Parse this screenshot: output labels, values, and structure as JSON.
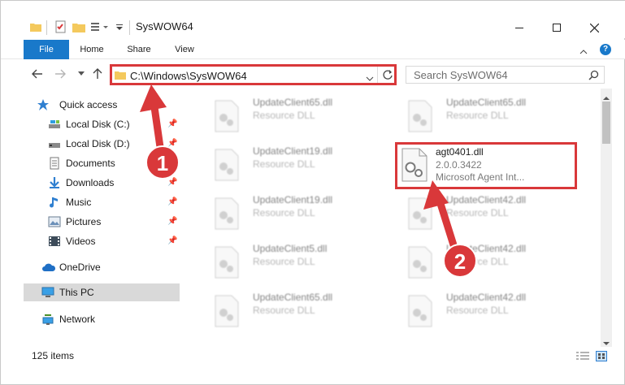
{
  "window": {
    "title": "SysWOW64"
  },
  "ribbon": {
    "tabs": [
      "File",
      "Home",
      "Share",
      "View"
    ],
    "help_label": "?"
  },
  "address": {
    "path": "C:\\Windows\\SysWOW64",
    "search_placeholder": "Search SysWOW64"
  },
  "nav": {
    "items": [
      {
        "label": "Quick access",
        "icon": "star-icon",
        "pinned": false
      },
      {
        "label": "Local Disk (C:)",
        "icon": "drive-icon",
        "pinned": true
      },
      {
        "label": "Local Disk (D:)",
        "icon": "drive-icon",
        "pinned": true
      },
      {
        "label": "Documents",
        "icon": "document-icon",
        "pinned": true
      },
      {
        "label": "Downloads",
        "icon": "download-icon",
        "pinned": true
      },
      {
        "label": "Music",
        "icon": "music-icon",
        "pinned": true
      },
      {
        "label": "Pictures",
        "icon": "pictures-icon",
        "pinned": true
      },
      {
        "label": "Videos",
        "icon": "video-icon",
        "pinned": true
      },
      {
        "label": "OneDrive",
        "icon": "cloud-icon",
        "pinned": false
      },
      {
        "label": "This PC",
        "icon": "computer-icon",
        "pinned": false,
        "selected": true
      },
      {
        "label": "Network",
        "icon": "network-icon",
        "pinned": false
      }
    ]
  },
  "files": {
    "left": [
      {
        "name": "UpdateClient65.dll",
        "desc": "Resource DLL"
      },
      {
        "name": "UpdateClient19.dll",
        "desc": "Resource DLL"
      },
      {
        "name": "UpdateClient19.dll",
        "desc": "Resource DLL"
      },
      {
        "name": "UpdateClient5.dll",
        "desc": "Resource DLL"
      },
      {
        "name": "UpdateClient65.dll",
        "desc": "Resource DLL"
      }
    ],
    "right": [
      {
        "name": "UpdateClient65.dll",
        "desc": "Resource DLL"
      },
      {
        "name": "UpdateClient42.dll",
        "desc": "Resource DLL"
      },
      {
        "name": "UpdateClient42.dll",
        "desc": "Resource DLL"
      },
      {
        "name": "UpdateClient42.dll",
        "desc": "Resource DLL"
      }
    ],
    "highlighted": {
      "name": "agt0401.dll",
      "version": "2.0.0.3422",
      "desc": "Microsoft Agent Int..."
    }
  },
  "status": {
    "count": "125 items"
  },
  "annotations": {
    "badge1": "1",
    "badge2": "2"
  },
  "colors": {
    "accent": "#1979ca",
    "highlight": "#d9383a"
  }
}
